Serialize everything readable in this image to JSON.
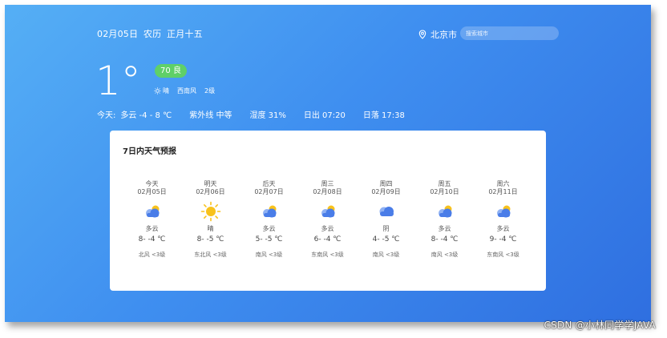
{
  "header": {
    "date": "02月05日",
    "lunar_label": "农历",
    "lunar_date": "正月十五",
    "city": "北京市",
    "search_placeholder": "搜索城市"
  },
  "current": {
    "temperature": "1°",
    "aqi": "70 良",
    "weather": "晴",
    "wind_direction": "西南风",
    "wind_level": "2级"
  },
  "today": {
    "label": "今天:",
    "condition_range": "多云 -4 - 8 ℃",
    "uv": "紫外线 中等",
    "humidity": "湿度 31%",
    "sunrise": "日出 07:20",
    "sunset": "日落 17:38"
  },
  "forecast": {
    "title": "7日内天气预报",
    "days": [
      {
        "name": "今天",
        "date": "02月05日",
        "icon": "cloudy-sun-icon",
        "cond": "多云",
        "range": "8- -4 ℃",
        "wind": "北风 <3级"
      },
      {
        "name": "明天",
        "date": "02月06日",
        "icon": "sun-icon",
        "cond": "晴",
        "range": "8- -5 ℃",
        "wind": "东北风 <3级"
      },
      {
        "name": "后天",
        "date": "02月07日",
        "icon": "cloudy-sun-icon",
        "cond": "多云",
        "range": "5- -5 ℃",
        "wind": "南风 <3级"
      },
      {
        "name": "周三",
        "date": "02月08日",
        "icon": "cloudy-sun-icon",
        "cond": "多云",
        "range": "6- -4 ℃",
        "wind": "东南风 <3级"
      },
      {
        "name": "周四",
        "date": "02月09日",
        "icon": "overcast-icon",
        "cond": "阴",
        "range": "4- -5 ℃",
        "wind": "南风 <3级"
      },
      {
        "name": "周五",
        "date": "02月10日",
        "icon": "cloudy-sun-icon",
        "cond": "多云",
        "range": "8- -4 ℃",
        "wind": "南风 <3级"
      },
      {
        "name": "周六",
        "date": "02月11日",
        "icon": "cloudy-sun-icon",
        "cond": "多云",
        "range": "9- -4 ℃",
        "wind": "东南风 <3级"
      }
    ]
  },
  "watermark": "CSDN @小林同学学JAVA",
  "colors": {
    "background_start": "#55aff5",
    "background_end": "#2f6fe0",
    "aqi_badge": "#5fd068",
    "card": "#ffffff",
    "sun": "#f8c21c",
    "cloud": "#4a7de8"
  }
}
